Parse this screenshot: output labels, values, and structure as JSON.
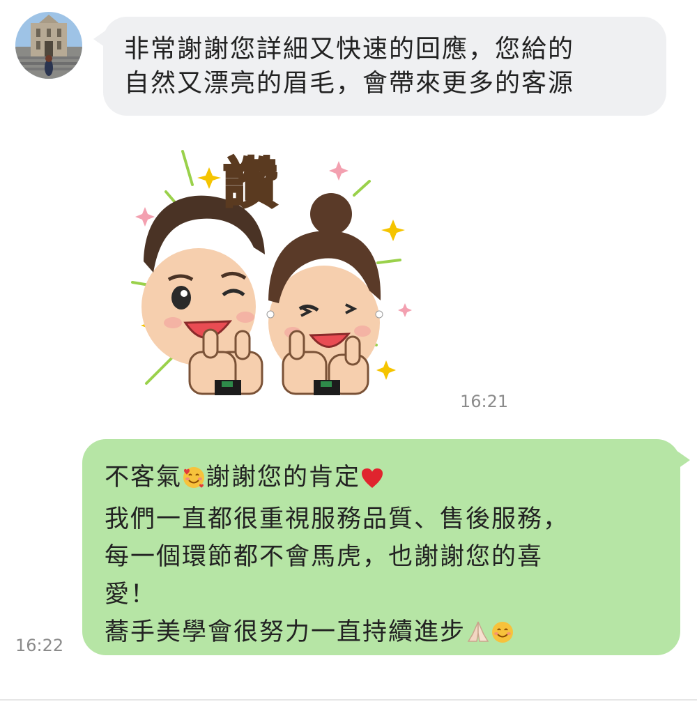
{
  "chat": {
    "incoming": {
      "line1": "非常謝謝您詳細又快速的回應，您給的",
      "line2": "自然又漂亮的眉毛，會帶來更多的客源",
      "avatar_icon": "avatar-ruins-photo-icon"
    },
    "sticker": {
      "text": "讚",
      "time": "16:21",
      "icon": "thumbs-up-couple-sticker"
    },
    "outgoing": {
      "line1": "不客氣",
      "line1_mid": "謝謝您的肯定",
      "line2": "我們一直都很重視服務品質、售後服務，",
      "line3": "每一個環節都不會馬虎，也謝謝您的喜",
      "line4": "愛！",
      "line5": "蕎手美學會很努力一直持續進步",
      "time": "16:22",
      "emojis": [
        "smiling-face-with-hearts",
        "red-heart",
        "folded-hands",
        "smiling-face"
      ]
    }
  },
  "colors": {
    "incoming_bubble": "#eff0f2",
    "outgoing_bubble": "#b6e5a5",
    "timestamp": "#8b8b8b"
  }
}
